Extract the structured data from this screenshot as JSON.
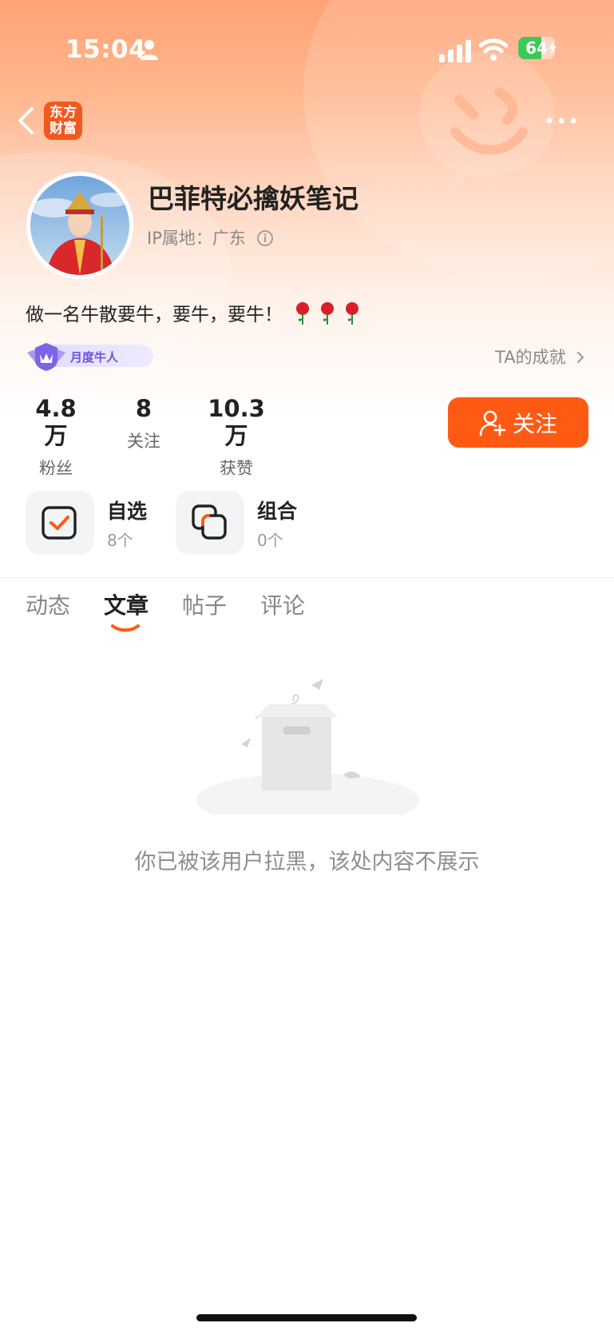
{
  "status_bar": {
    "time": "15:04",
    "battery_level": "64",
    "battery_fraction": 0.64,
    "battery_color": "#3fc85a"
  },
  "header": {
    "app_logo_line1": "东方",
    "app_logo_line2": "财富"
  },
  "profile": {
    "username": "巴菲特必擒妖笔记",
    "ip_location": "IP属地：广东",
    "bio": "做一名牛散要牛，要牛，要牛！",
    "badge": "月度牛人",
    "achievements_link": "TA的成就"
  },
  "stats": [
    {
      "value": "4.8万",
      "label": "粉丝"
    },
    {
      "value": "8",
      "label": "关注"
    },
    {
      "value": "10.3万",
      "label": "获赞"
    }
  ],
  "follow_button": {
    "label": "关注",
    "color": "#ff5a14"
  },
  "assets": [
    {
      "name": "自选",
      "count": "8个",
      "icon": "checkbox-icon"
    },
    {
      "name": "组合",
      "count": "0个",
      "icon": "overlap-squares-icon"
    }
  ],
  "tabs": [
    {
      "label": "动态",
      "active": false
    },
    {
      "label": "文章",
      "active": true
    },
    {
      "label": "帖子",
      "active": false
    },
    {
      "label": "评论",
      "active": false
    }
  ],
  "empty_state": {
    "message": "你已被该用户拉黑，该处内容不展示",
    "icon": "empty-box-icon"
  },
  "colors": {
    "accent": "#ff5a14",
    "brand": "#f05a1f",
    "badge_text": "#6a53d9"
  }
}
